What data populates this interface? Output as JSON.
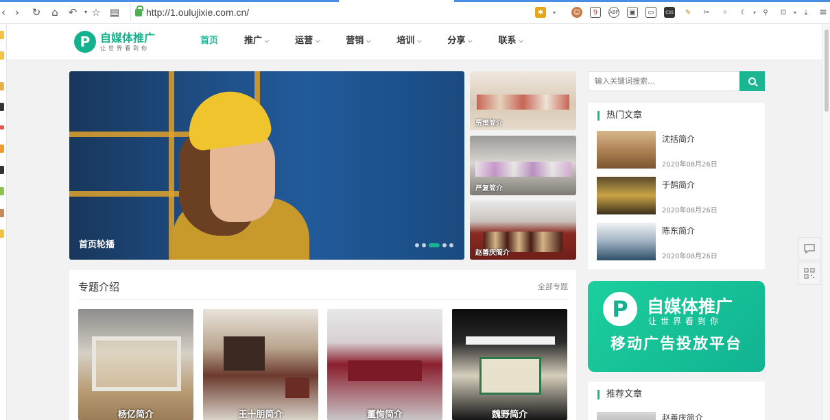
{
  "browser": {
    "url": "http://1.oulujixie.com.cn/"
  },
  "site": {
    "logo_mark": "P",
    "logo_title": "自媒体推广",
    "logo_slogan": "让世界看到你",
    "nav": [
      {
        "label": "首页",
        "active": true,
        "dropdown": false
      },
      {
        "label": "推广",
        "active": false,
        "dropdown": true
      },
      {
        "label": "运营",
        "active": false,
        "dropdown": true
      },
      {
        "label": "营销",
        "active": false,
        "dropdown": true
      },
      {
        "label": "培训",
        "active": false,
        "dropdown": true
      },
      {
        "label": "分享",
        "active": false,
        "dropdown": true
      },
      {
        "label": "联系",
        "active": false,
        "dropdown": true
      }
    ]
  },
  "slider": {
    "caption": "首页轮播",
    "dot_count": 5,
    "active_dot": 3
  },
  "side_thumbs": [
    {
      "caption": "贾策简介"
    },
    {
      "caption": "严复简介"
    },
    {
      "caption": "赵善庆简介"
    }
  ],
  "search": {
    "placeholder": "输入关键词搜索..."
  },
  "hot_articles": {
    "title": "热门文章",
    "items": [
      {
        "title": "沈括简介",
        "date": "2020年08月26日"
      },
      {
        "title": "于鹄简介",
        "date": "2020年08月26日"
      },
      {
        "title": "陈东简介",
        "date": "2020年08月26日"
      }
    ]
  },
  "banner": {
    "mark": "P",
    "title": "自媒体推广",
    "slogan": "让世界看到你",
    "subtitle": "移动广告投放平台"
  },
  "recommended": {
    "title": "推荐文章",
    "first_item": "赵善庆简介"
  },
  "topics": {
    "title": "专题介绍",
    "more": "全部专题",
    "cards": [
      {
        "caption": "杨亿简介"
      },
      {
        "caption": "王十朋简介"
      },
      {
        "caption": "董恂简介"
      },
      {
        "caption": "魏野简介"
      }
    ]
  },
  "colors": {
    "accent": "#1cb592",
    "nav_active": "#1db794"
  }
}
